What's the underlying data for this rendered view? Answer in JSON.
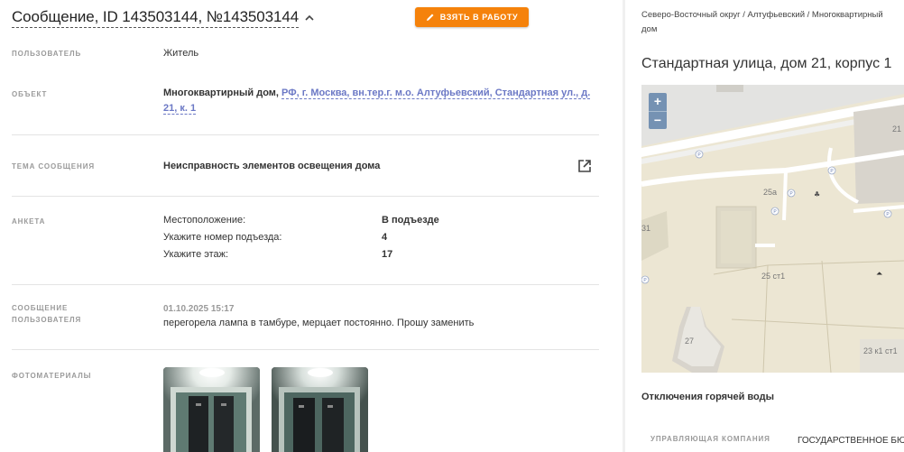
{
  "header": {
    "title": "Сообщение, ID 143503144, №143503144",
    "take_button": "ВЗЯТЬ В РАБОТУ"
  },
  "fields": {
    "user": {
      "label": "ПОЛЬЗОВАТЕЛЬ",
      "value": "Житель"
    },
    "object": {
      "label": "ОБЪЕКТ",
      "type": "Многоквартирный дом,",
      "address": "РФ, г. Москва, вн.тер.г. м.о. Алтуфьевский, Стандартная ул., д. 21, к. 1"
    },
    "topic": {
      "label": "ТЕМА СООБЩЕНИЯ",
      "value": "Неисправность элементов освещения дома"
    },
    "form": {
      "label": "АНКЕТА",
      "rows": [
        {
          "q": "Местоположение:",
          "a": "В подъезде"
        },
        {
          "q": "Укажите номер подъезда:",
          "a": "4"
        },
        {
          "q": "Укажите этаж:",
          "a": "17"
        }
      ]
    },
    "user_message": {
      "label_line1": "СООБЩЕНИЕ",
      "label_line2": "ПОЛЬЗОВАТЕЛЯ",
      "date": "01.10.2025 15:17",
      "text": "перегорела лампа в тамбуре, мерцает постоянно. Прошу заменить"
    },
    "photos": {
      "label": "ФОТОМАТЕРИАЛЫ"
    }
  },
  "side": {
    "breadcrumb_line1": "Северо-Восточный округ / Алтуфьевский / Многоквартирный",
    "breadcrumb_line2": "дом",
    "address_title": "Стандартная улица, дом 21, корпус 1",
    "map": {
      "zoom_in": "+",
      "zoom_out": "−",
      "labels": {
        "b21": "21",
        "b25a": "25а",
        "b31": "31",
        "b25st1": "25 ст1",
        "b27": "27",
        "b23": "23 к1 ст1",
        "parking": "P"
      }
    },
    "hot_water": "Отключения горячей воды",
    "company_label": "УПРАВЛЯЮЩАЯ КОМПАНИЯ",
    "company_value": "ГОСУДАРСТВЕННОЕ БЮ"
  },
  "colors": {
    "accent_orange": "#f5820b",
    "link_purple": "#6b78c5",
    "zoom_blue": "#7592b3"
  }
}
